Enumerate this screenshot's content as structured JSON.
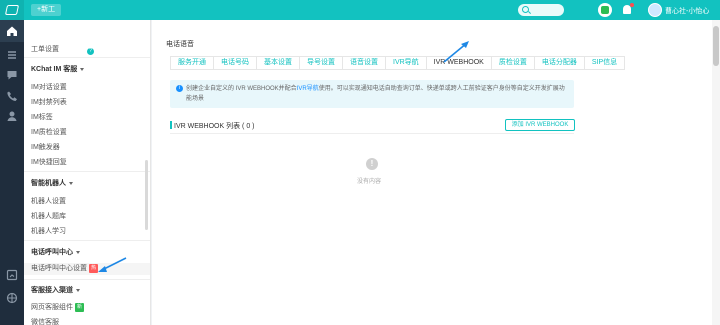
{
  "topbar": {
    "new_label": "+新工",
    "user_name": "曹心社-小怡心"
  },
  "rail": {
    "tooltip": "主页"
  },
  "subnav": {
    "partial_top": "工单设置",
    "kchat_group": "KChat IM 客服",
    "im_items": [
      "IM对话设置",
      "IM封禁列表",
      "IM标签",
      "IM质检设置",
      "IM触发器",
      "IM快捷回复"
    ],
    "robot_group": "智能机器人",
    "robot_items": [
      "机器人设置",
      "机器人题库",
      "机器人学习"
    ],
    "callcenter_group": "电话呼叫中心",
    "callcenter_item": "电话呼叫中心设置",
    "callcenter_badge": "热",
    "access_group": "客服接入渠道",
    "access_items": [
      "网页客服组件",
      "微信客服"
    ],
    "access_badge": "新"
  },
  "main": {
    "page_title": "电话语音",
    "tabs": [
      "服务开通",
      "电话号码",
      "基本设置",
      "导号设置",
      "语音设置",
      "IVR导航",
      "IVR WEBHOOK",
      "质检设置",
      "电话分配器",
      "SIP信息"
    ],
    "active_tab_index": 6,
    "notice_part1": "创建企业自定义的 IVR WEBHOOK并配合",
    "notice_link": "IVR导航",
    "notice_part2": "使用。可以实现通知电话自助查询订单、快递单或跨人工前验证客户身份等自定义开发扩展功能场景",
    "section_title": "IVR WEBHOOK 列表 ( 0 )",
    "add_button": "添加 IVR WEBHOOK",
    "empty_text": "没有内容"
  },
  "colors": {
    "brand": "#12c2c0",
    "rail": "#1f2d3d",
    "hot": "#ff5a5a",
    "new": "#2dbd54",
    "annotation_arrow": "#1e88e5"
  },
  "icons": {
    "rail": [
      "home-icon",
      "list-icon",
      "chat-icon",
      "phone-icon",
      "user-icon",
      "report-icon",
      "settings-icon"
    ],
    "topbar": [
      "search-icon",
      "wechat-icon",
      "bell-icon",
      "avatar"
    ]
  }
}
